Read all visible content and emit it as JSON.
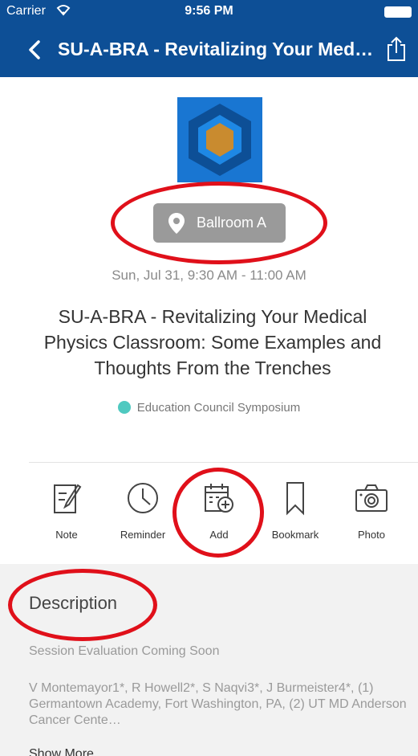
{
  "status_bar": {
    "carrier": "Carrier",
    "time": "9:56 PM"
  },
  "nav": {
    "title": "SU-A-BRA - Revitalizing Your Med…"
  },
  "location": {
    "label": "Ballroom A",
    "icon": "map-pin-icon"
  },
  "session": {
    "datetime": "Sun, Jul 31, 9:30 AM - 11:00 AM",
    "title": "SU-A-BRA - Revitalizing Your Medical Physics Classroom: Some Examples and Thoughts From the Trenches",
    "track": "Education Council Symposium",
    "track_color": "#4fc9c0"
  },
  "actions": [
    {
      "label": "Note",
      "icon": "note-edit-icon"
    },
    {
      "label": "Reminder",
      "icon": "clock-icon"
    },
    {
      "label": "Add",
      "icon": "calendar-add-icon"
    },
    {
      "label": "Bookmark",
      "icon": "bookmark-icon"
    },
    {
      "label": "Photo",
      "icon": "camera-icon"
    }
  ],
  "description": {
    "heading": "Description",
    "evaluation": "Session Evaluation Coming Soon",
    "authors": "V Montemayor1*, R Howell2*, S Naqvi3*, J Burmeister4*, (1) Germantown Academy, Fort Washington, PA, (2) UT MD Anderson Cancer Cente…",
    "show_more": "Show More"
  },
  "colors": {
    "nav_bg": "#0d4f96",
    "highlight_ring": "#e0101a"
  }
}
